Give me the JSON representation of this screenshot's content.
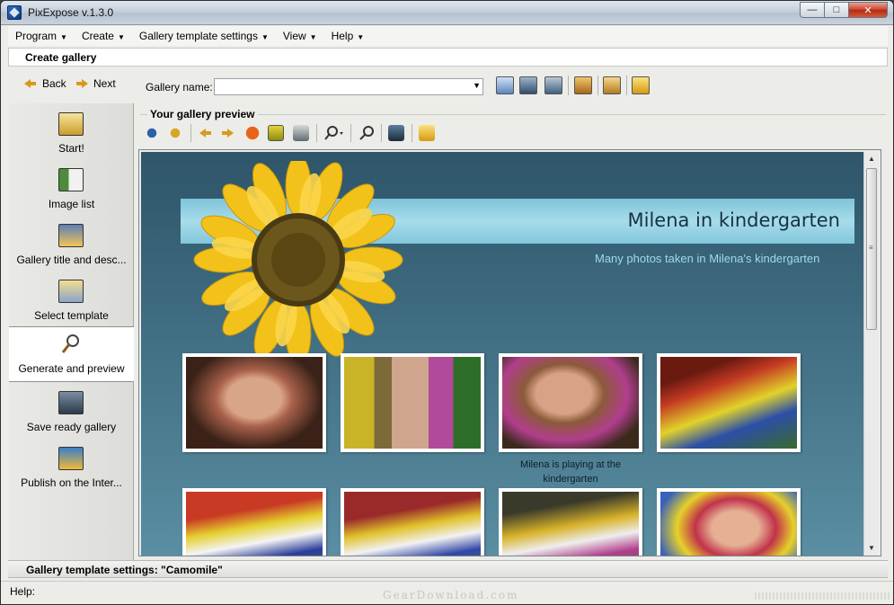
{
  "window": {
    "title": "PixExpose v.1.3.0"
  },
  "menu": [
    {
      "label": "Program"
    },
    {
      "label": "Create"
    },
    {
      "label": "Gallery template settings"
    },
    {
      "label": "View"
    },
    {
      "label": "Help"
    }
  ],
  "section_title": "Create gallery",
  "toolbar": {
    "back_label": "Back",
    "next_label": "Next",
    "gallery_name_label": "Gallery name:",
    "gallery_name_value": ""
  },
  "steps": [
    {
      "label": "Start!",
      "icon": "film-icon"
    },
    {
      "label": "Image list",
      "icon": "image-list-icon"
    },
    {
      "label": "Gallery title and desc...",
      "icon": "folder-images-icon"
    },
    {
      "label": "Select template",
      "icon": "template-icon"
    },
    {
      "label": "Generate and preview",
      "icon": "magnifier-icon",
      "active": true
    },
    {
      "label": "Save ready gallery",
      "icon": "floppy-icon"
    },
    {
      "label": "Publish on the Inter...",
      "icon": "network-icon"
    }
  ],
  "preview": {
    "heading": "Your gallery preview",
    "gallery_title": "Milena in kindergarten",
    "gallery_description": "Many photos taken in Milena's kindergarten",
    "caption": "Milena is playing at the kindergarten"
  },
  "template_bar": "Gallery template settings: \"Camomile\"",
  "status": {
    "help_label": "Help:",
    "watermark": "GearDownload.com"
  },
  "colors": {
    "accent": "#d99a1c",
    "canvas_top": "#2f5569",
    "canvas_bottom": "#5a8ea2",
    "banner": "#a8dcea",
    "subtitle": "#9fd9ec"
  }
}
